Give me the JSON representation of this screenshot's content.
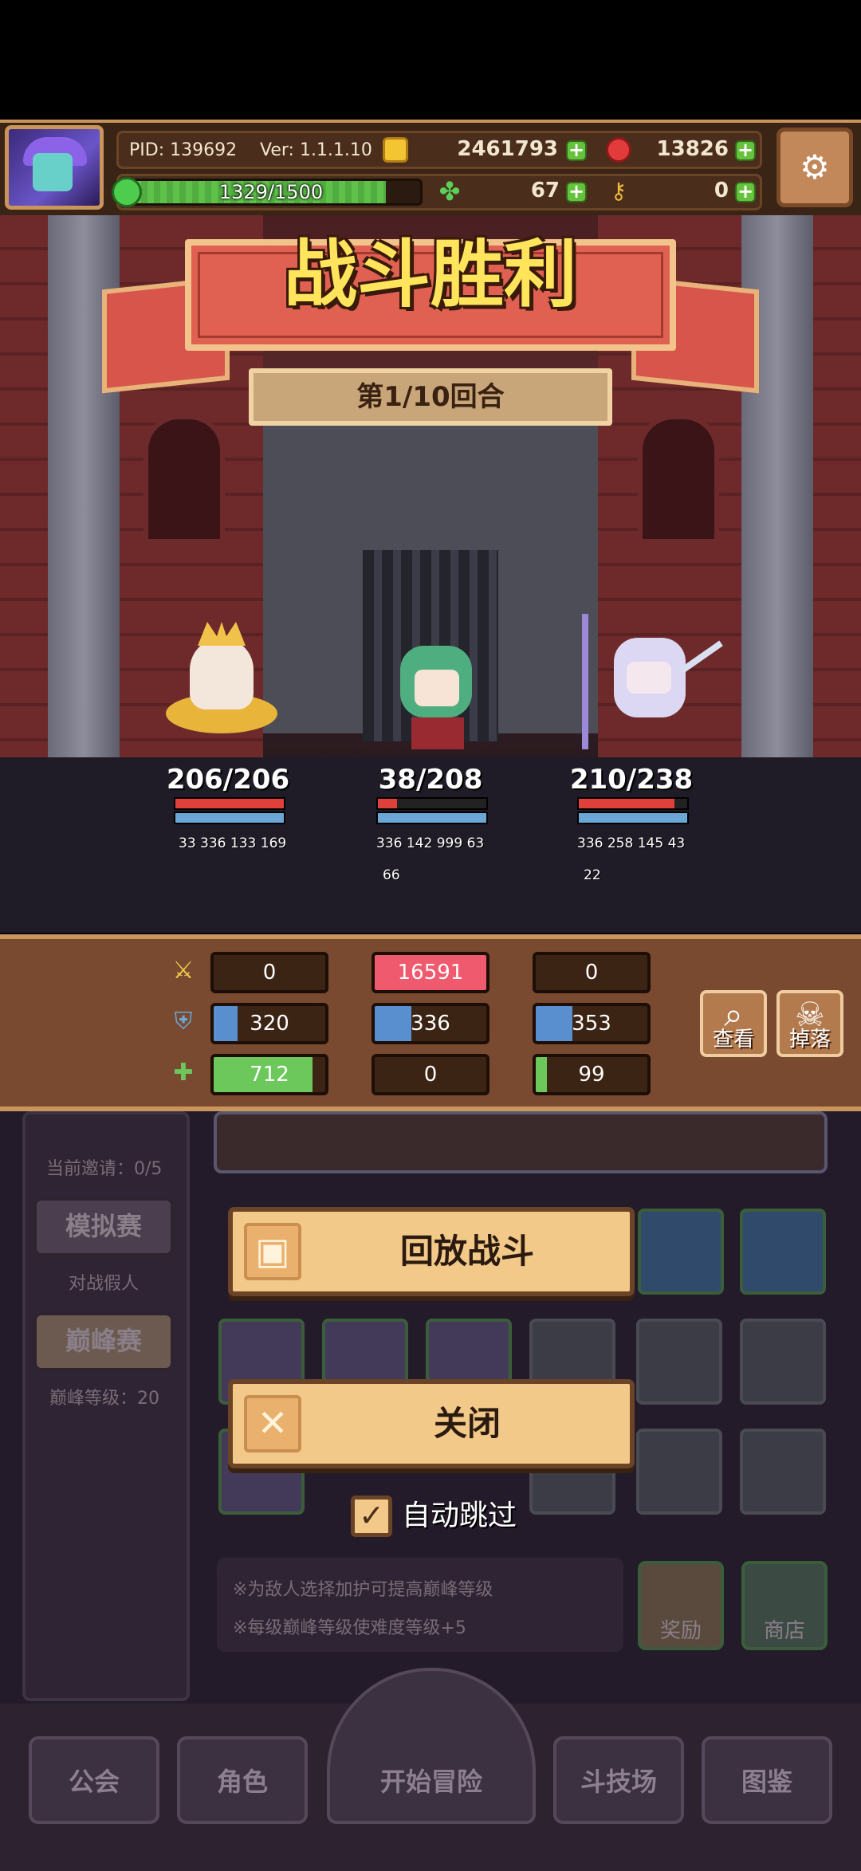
{
  "header": {
    "pid": "PID: 139692",
    "version": "Ver: 1.1.1.10",
    "gold": "2461793",
    "gems": "13826",
    "energy": "1329/1500",
    "energy_fraction": 0.886,
    "clover": "67",
    "keys": "0",
    "plus_glyph": "+"
  },
  "battle": {
    "title": "战斗胜利",
    "round": "第1/10回合",
    "heroes": [
      {
        "hp": "206/206",
        "hp_fraction": 1.0,
        "stats": [
          "33",
          "336",
          "133",
          "169"
        ],
        "extra": ""
      },
      {
        "hp": "38/208",
        "hp_fraction": 0.18,
        "stats": [
          "336",
          "142",
          "999",
          "63"
        ],
        "extra": "66"
      },
      {
        "hp": "210/238",
        "hp_fraction": 0.88,
        "stats": [
          "336",
          "258",
          "145",
          "43"
        ],
        "extra": "22"
      }
    ]
  },
  "stats_panel": {
    "damage": [
      "0",
      "16591",
      "0"
    ],
    "defense": [
      "320",
      "336",
      "353"
    ],
    "heal": [
      "712",
      "0",
      "99"
    ],
    "view_label": "查看",
    "drop_label": "掉落"
  },
  "background": {
    "invites": "当前邀请：0/5",
    "mock_label": "模拟赛",
    "mock_sub": "对战假人",
    "peak_label": "巅峰赛",
    "peak_level": "巅峰等级：20",
    "tip1": "※为敌人选择加护可提高巅峰等级",
    "tip2": "※每级巅峰等级使难度等级+5",
    "reward_label": "奖励",
    "shop_label": "商店"
  },
  "dialog": {
    "replay_label": "回放战斗",
    "close_label": "关闭",
    "auto_skip_label": "自动跳过"
  },
  "nav": {
    "guild": "公会",
    "character": "角色",
    "start": "开始冒险",
    "arena": "斗技场",
    "codex": "图鉴"
  },
  "colors": {
    "title_yellow": "#ffe45c",
    "banner_red": "#e06152",
    "hp_red": "#e0403a",
    "damage_highlight": "#f05a6e",
    "heal_green": "#6cc85a",
    "defense_blue": "#5a8fcf"
  }
}
